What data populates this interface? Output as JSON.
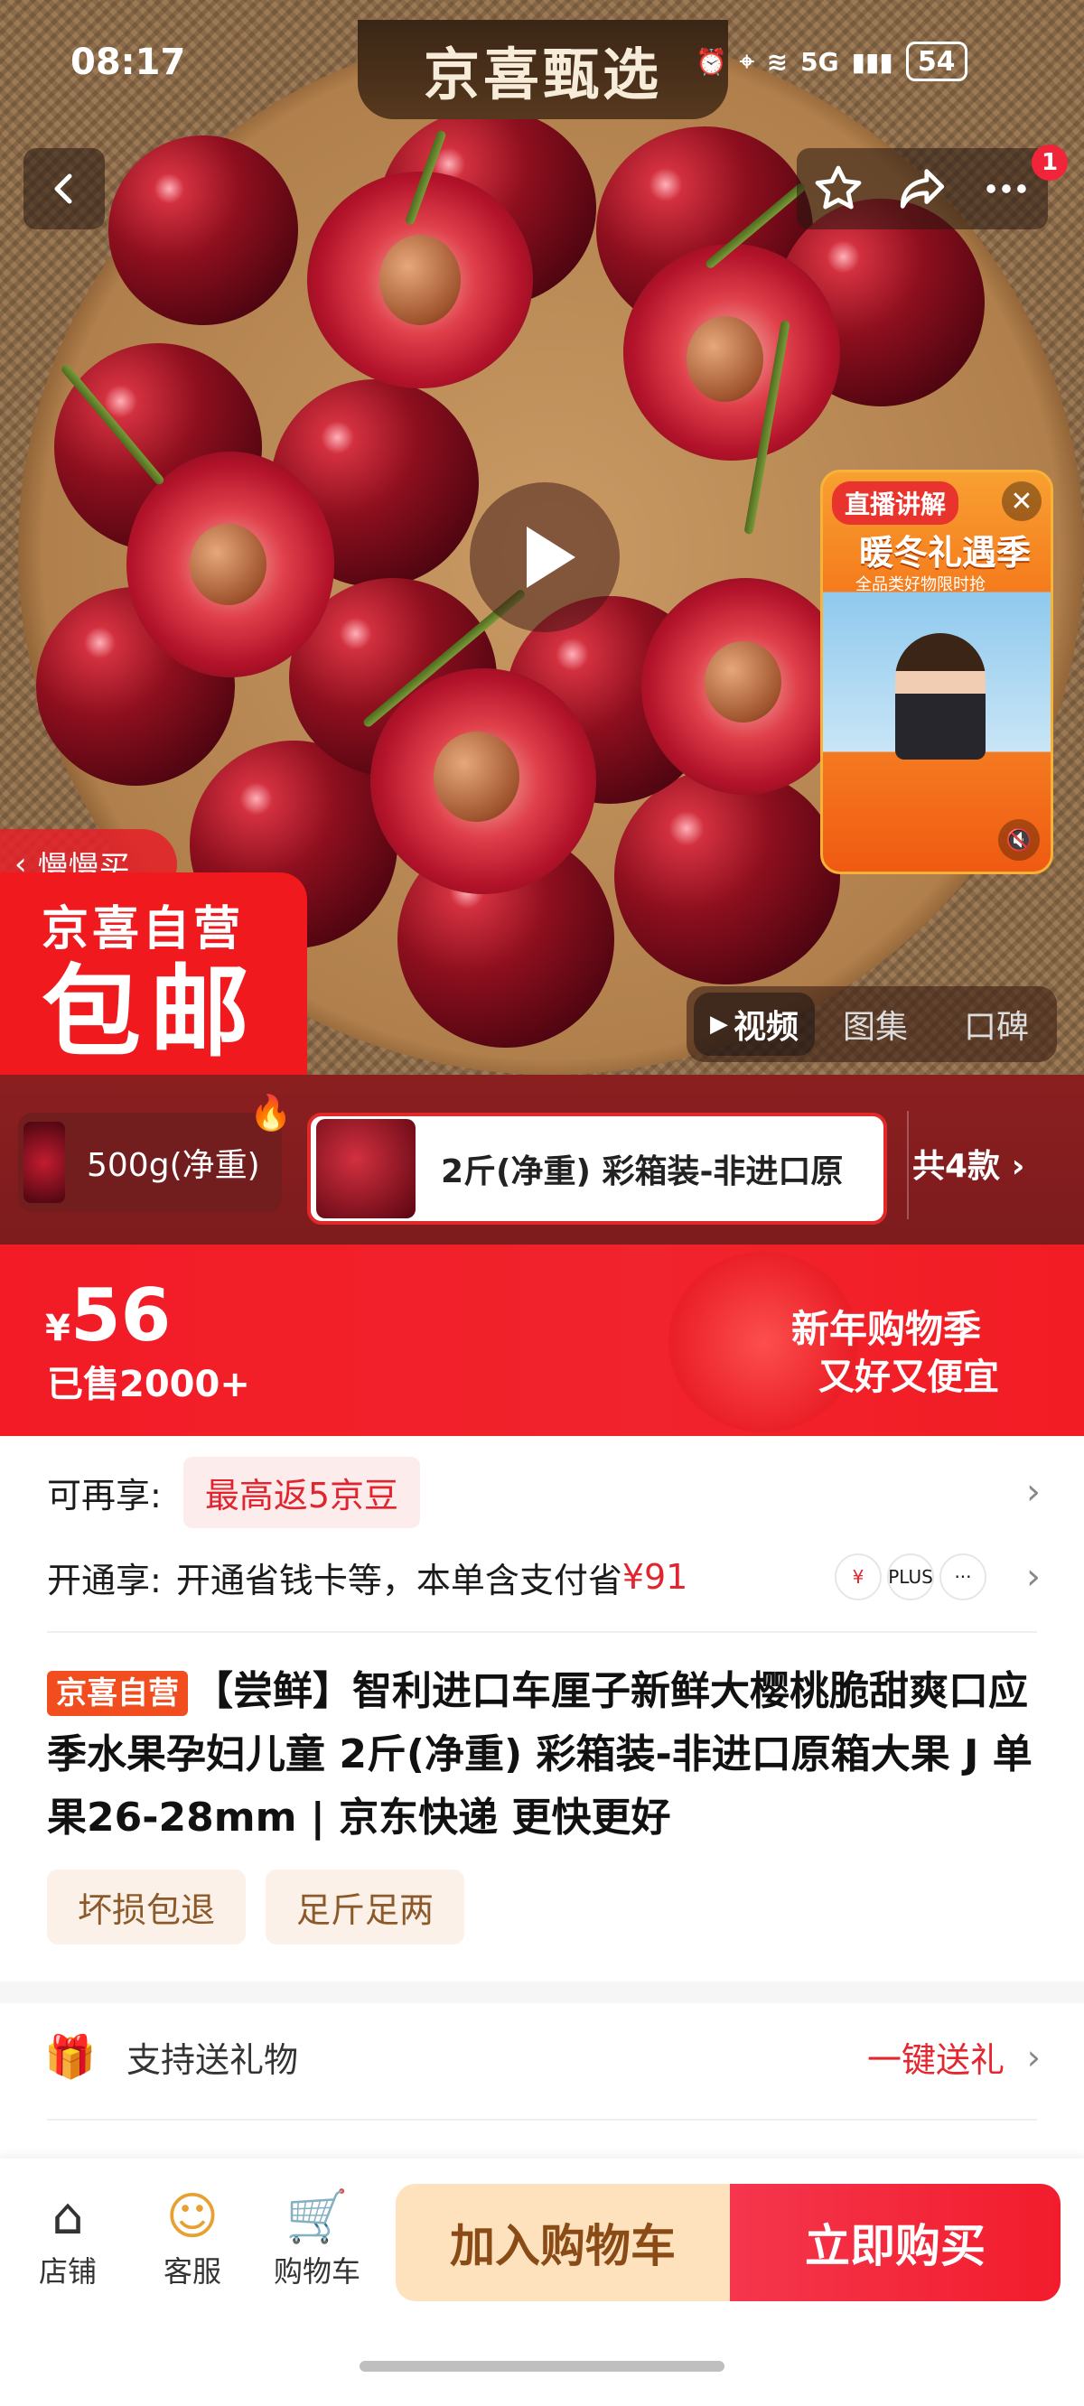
{
  "status": {
    "time": "08:17",
    "network": "5G",
    "battery": "54"
  },
  "brand": {
    "name": "京喜甄选"
  },
  "hero": {
    "cart_badge": "1",
    "live": {
      "title": "直播讲解",
      "banner": "暖冬礼遇季",
      "sub": "全品类好物限时抢"
    },
    "slow_buy": "慢慢买",
    "ship_line1": "京喜自营",
    "ship_line2": "包邮",
    "media_tabs": [
      "视频",
      "图集",
      "口碑"
    ]
  },
  "variants": {
    "items": [
      "500g(净重)",
      "2斤(净重) 彩箱装-非进口原"
    ],
    "count": "共4款"
  },
  "price": {
    "currency": "¥",
    "amount": "56",
    "sold": "已售2000+",
    "promo_title": "新年购物季",
    "promo_sub": "又好又便宜"
  },
  "benefits": {
    "row1_label": "可再享:",
    "row1_value": "最高返5京豆",
    "row2_label": "开通享:",
    "row2_value": "开通省钱卡等，本单含支付省",
    "row2_amount": "¥91",
    "plus": "PLUS"
  },
  "product": {
    "store_tag": "京喜自营",
    "title": "【尝鲜】智利进口车厘子新鲜大樱桃脆甜爽口应季水果孕妇儿童 2斤(净重) 彩箱装-非进口原箱大果 J 单果26-28mm | 京东快递 更快更好",
    "tags": [
      "坏损包退",
      "足斤足两"
    ]
  },
  "gift": {
    "label": "支持送礼物",
    "action": "一键送礼"
  },
  "bottom": {
    "icons": [
      "店铺",
      "客服",
      "购物车"
    ],
    "add_cart": "加入购物车",
    "buy_now": "立即购买"
  },
  "colors": {
    "accent": "#f21c2c",
    "cart_btn": "#fde2bd",
    "price_bg": "#f21b26"
  }
}
